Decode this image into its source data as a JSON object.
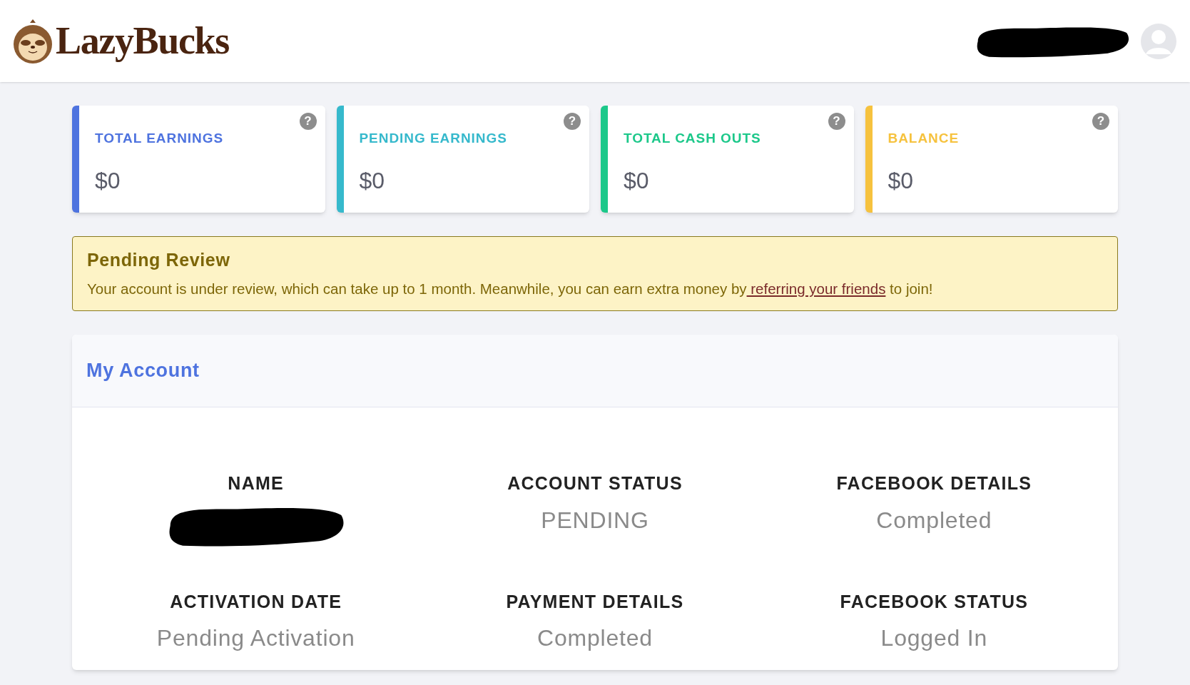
{
  "header": {
    "logo": "LazyBucks",
    "user": {
      "redacted": true
    }
  },
  "stats": [
    {
      "label": "TOTAL EARNINGS",
      "value": "$0",
      "color": "#4e73df",
      "help": "?"
    },
    {
      "label": "PENDING EARNINGS",
      "value": "$0",
      "color": "#36b9cc",
      "help": "?"
    },
    {
      "label": "TOTAL CASH OUTS",
      "value": "$0",
      "color": "#1cc88a",
      "help": "?"
    },
    {
      "label": "BALANCE",
      "value": "$0",
      "color": "#f6c23e",
      "help": "?"
    }
  ],
  "alert": {
    "title": "Pending Review",
    "text": "Your account is under review, which can take up to 1 month. Meanwhile, you can earn extra money by",
    "link": " referring your friends",
    "after": " to join!"
  },
  "account": {
    "title": "My Account",
    "fields": [
      {
        "label": "NAME",
        "kind": "redacted"
      },
      {
        "label": "ACCOUNT STATUS",
        "kind": "text",
        "value": "PENDING"
      },
      {
        "label": "FACEBOOK DETAILS",
        "kind": "text",
        "value": "Completed"
      },
      {
        "label": "ACTIVATION DATE",
        "kind": "text",
        "value": "Pending Activation"
      },
      {
        "label": "PAYMENT DETAILS",
        "kind": "text",
        "value": "Completed"
      },
      {
        "label": "FACEBOOK STATUS",
        "kind": "text",
        "value": "Logged In"
      }
    ]
  }
}
